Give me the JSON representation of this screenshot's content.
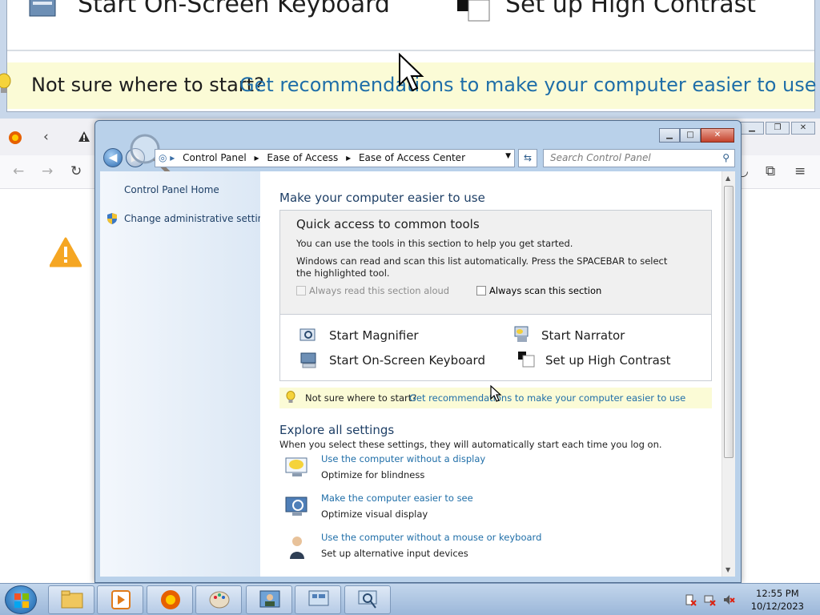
{
  "magnifier": {
    "tool_left": "Start On-Screen Keyboard",
    "tool_right": "Set up High Contrast",
    "tip_question": "Not sure where to start?",
    "tip_link": "Get recommendations to make your computer easier to use"
  },
  "window": {
    "breadcrumbs": [
      "Control Panel",
      "Ease of Access",
      "Ease of Access Center"
    ],
    "search_placeholder": "Search Control Panel"
  },
  "left_pane": {
    "home": "Control Panel Home",
    "admin": "Change administrative settings"
  },
  "main": {
    "heading": "Make your computer easier to use",
    "quick_access": {
      "title": "Quick access to common tools",
      "line1": "You can use the tools in this section to help you get started.",
      "line2": "Windows can read and scan this list automatically.  Press the SPACEBAR to select the highlighted tool.",
      "read_aloud": "Always read this section aloud",
      "read_aloud_checked": false,
      "scan": "Always scan this section",
      "scan_checked": false,
      "tools": [
        "Start Magnifier",
        "Start Narrator",
        "Start On-Screen Keyboard",
        "Set up High Contrast"
      ]
    },
    "tip": {
      "question": "Not sure where to start?",
      "link": "Get recommendations to make your computer easier to use"
    },
    "explore": {
      "heading": "Explore all settings",
      "description": "When you select these settings, they will automatically start each time you log on.",
      "settings": [
        {
          "link": "Use the computer without a display",
          "desc": "Optimize for blindness"
        },
        {
          "link": "Make the computer easier to see",
          "desc": "Optimize visual display"
        },
        {
          "link": "Use the computer without a mouse or keyboard",
          "desc": "Set up alternative input devices"
        }
      ]
    }
  },
  "taskbar": {
    "time": "12:55 PM",
    "date": "10/12/2023"
  }
}
